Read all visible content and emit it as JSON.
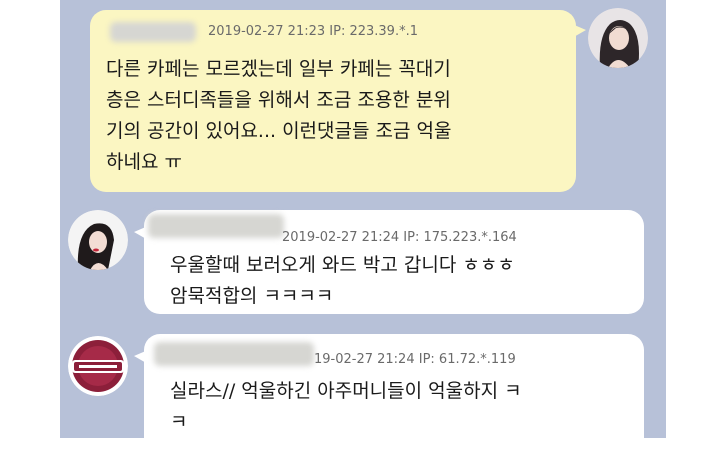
{
  "messages": [
    {
      "side": "right",
      "meta": "2019-02-27 21:23  IP: 223.39.*.1",
      "lines": [
        "다른 카페는 모르겠는데 일부 카페는 꼭대기",
        "층은 스터디족들을 위해서 조금 조용한 분위",
        "기의 공간이 있어요... 이런댓글들 조금 억울",
        "하네요 ㅠ"
      ],
      "avatar_icon": "profile-photo-woman"
    },
    {
      "side": "left",
      "meta": "2019-02-27 21:24  IP: 175.223.*.164",
      "lines": [
        "우울할때 보러오게 와드 박고 갑니다 ㅎㅎㅎ",
        "암묵적합의 ㅋㅋㅋㅋ"
      ],
      "avatar_icon": "profile-photo-woman"
    },
    {
      "side": "left",
      "meta": "19-02-27 21:24  IP: 61.72.*.119",
      "lines": [
        "실라스// 억울하긴 아주머니들이 억울하지 ㅋ",
        "ㅋ"
      ],
      "avatar_icon": "kiwoom-heroes-logo"
    }
  ],
  "colors": {
    "background": "#b7c1d8",
    "bubble_right": "#fbf6c2",
    "bubble_left": "#ffffff",
    "logo_red": "#8c1f3a"
  }
}
